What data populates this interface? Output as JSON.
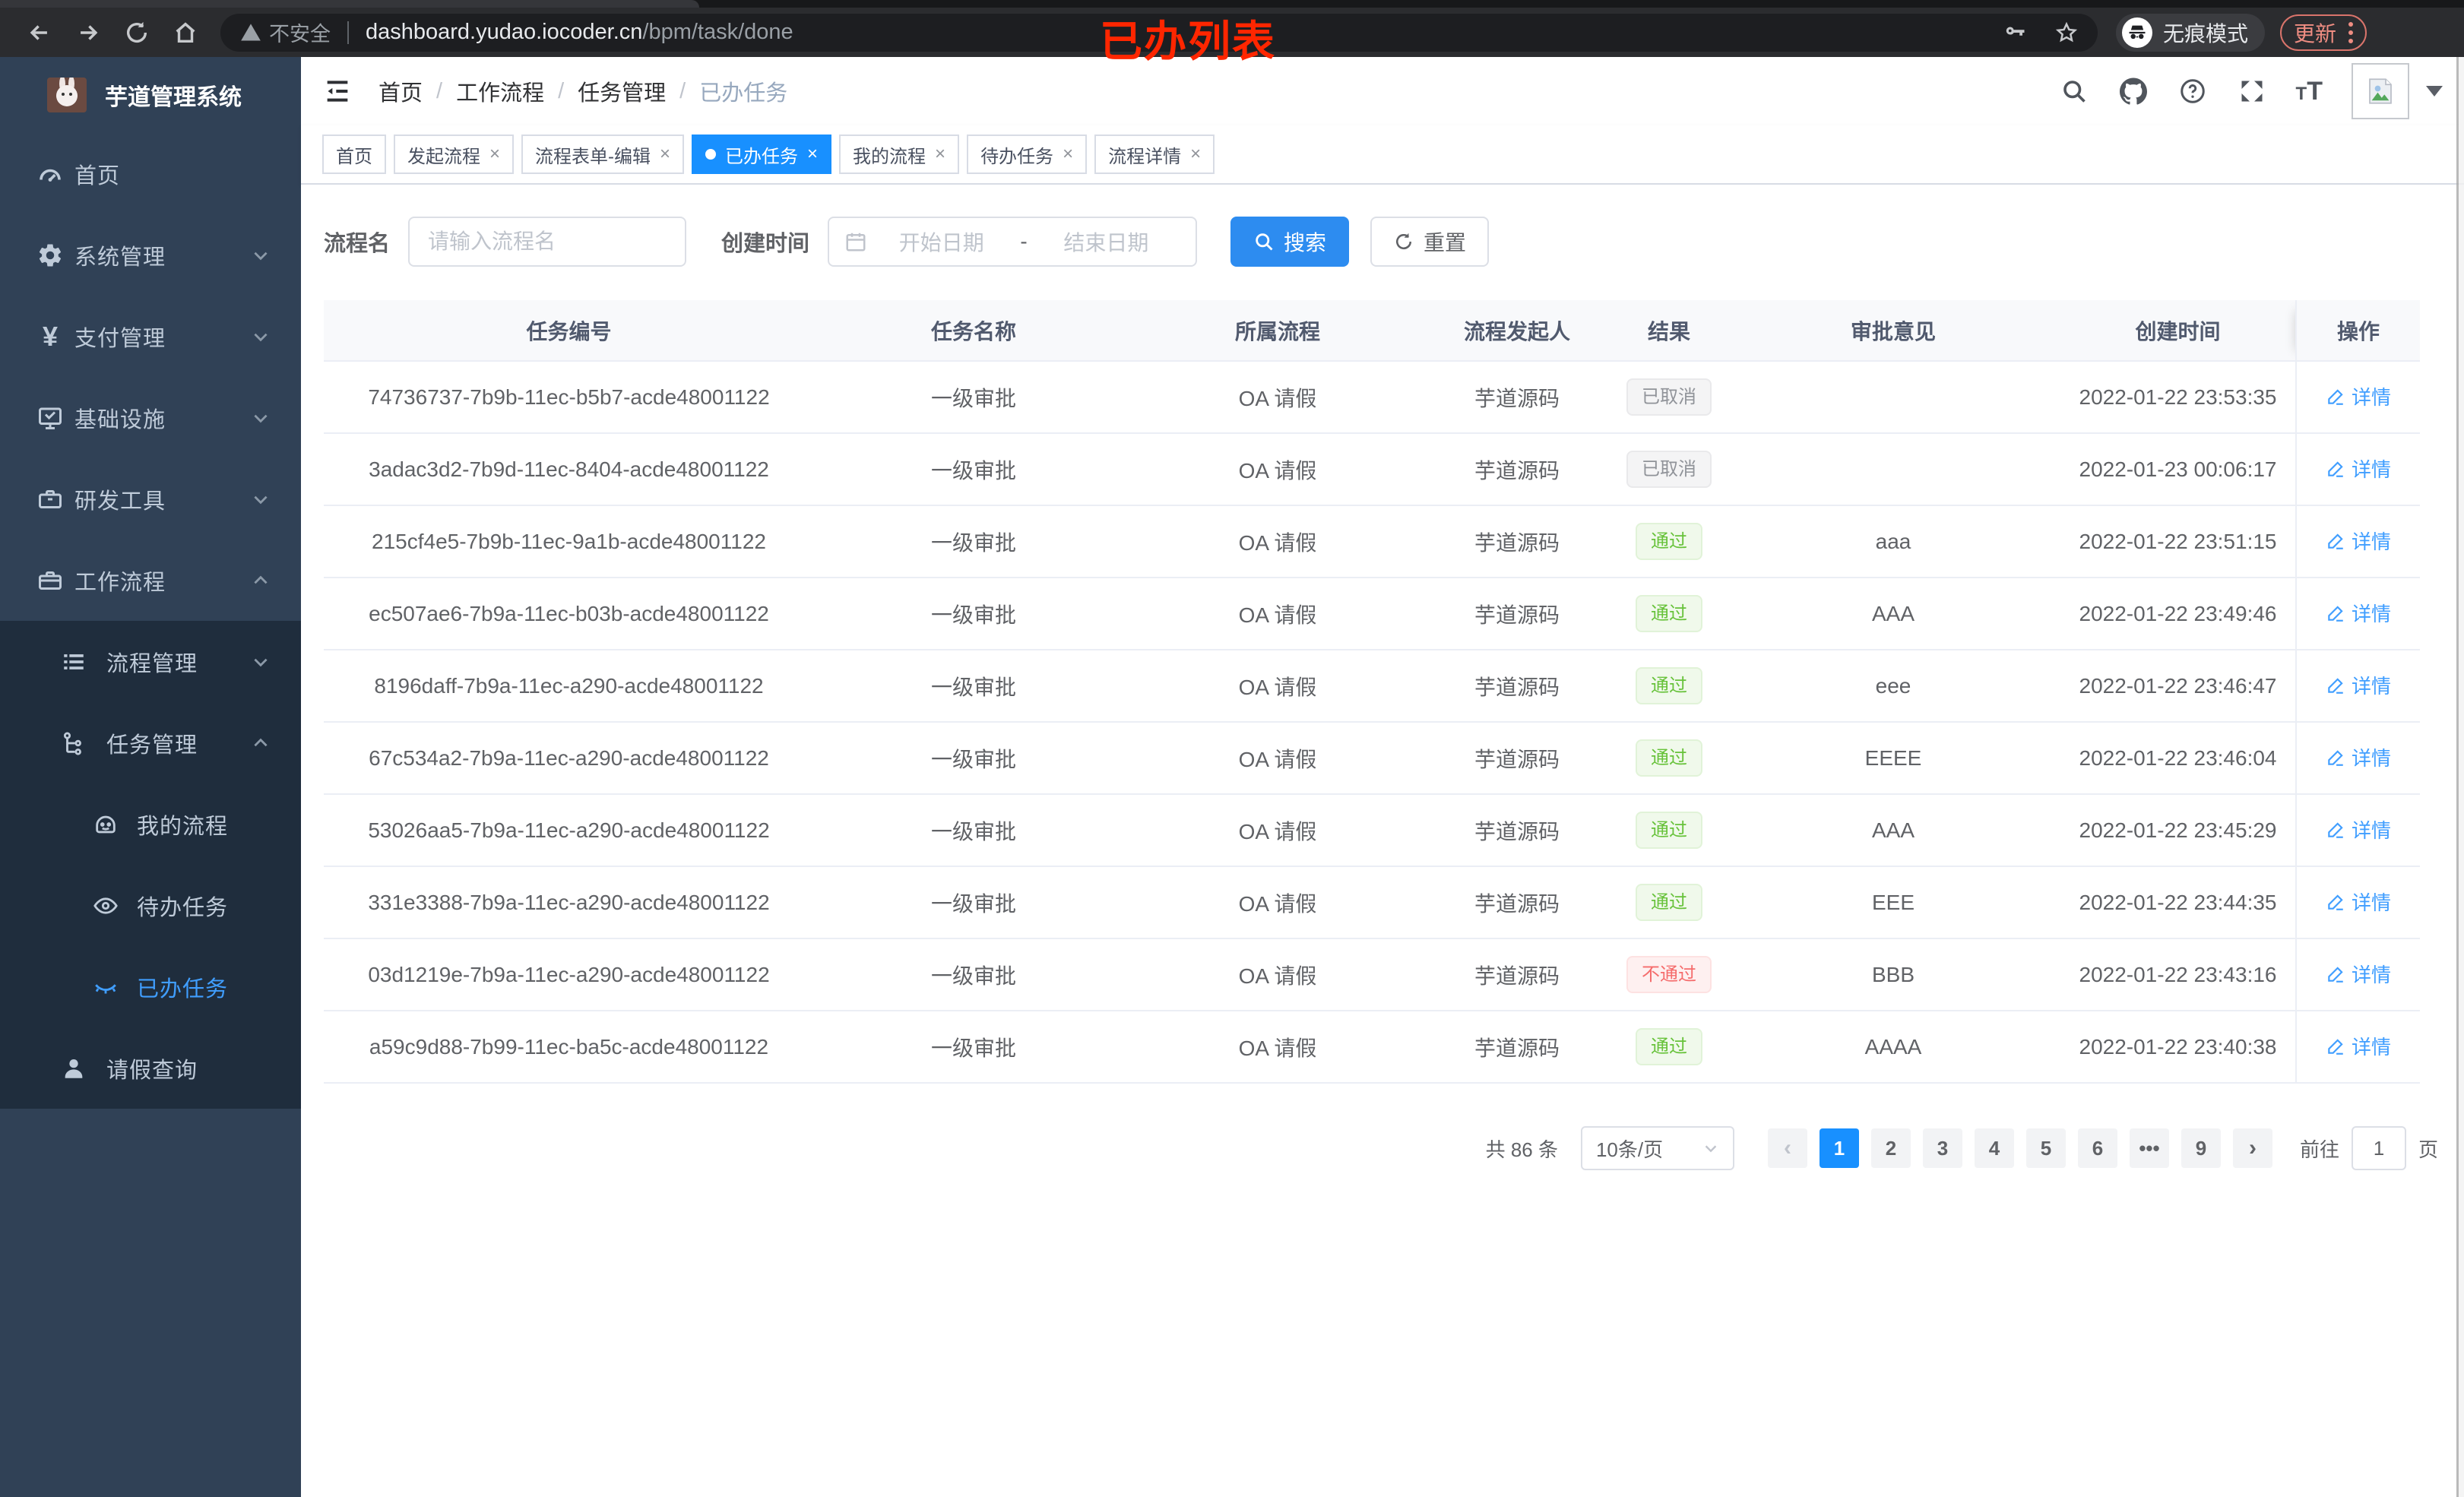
{
  "browser": {
    "not_secure": "不安全",
    "url_host": "dashboard.yudao.iocoder.cn",
    "url_path": "/bpm/task/done",
    "incognito_label": "无痕模式",
    "update_label": "更新"
  },
  "annotation": "已办列表",
  "sidebar": {
    "title": "芋道管理系统",
    "items": [
      {
        "label": "首页",
        "icon": "dashboard-icon"
      },
      {
        "label": "系统管理",
        "icon": "gear-icon"
      },
      {
        "label": "支付管理",
        "icon": "yen-icon"
      },
      {
        "label": "基础设施",
        "icon": "monitor-icon"
      },
      {
        "label": "研发工具",
        "icon": "toolbox-icon"
      },
      {
        "label": "工作流程",
        "icon": "briefcase-icon"
      }
    ],
    "submenu": {
      "process_mgmt": "流程管理",
      "task_mgmt": "任务管理",
      "my_process": "我的流程",
      "todo_tasks": "待办任务",
      "done_tasks": "已办任务",
      "leave_query": "请假查询"
    }
  },
  "breadcrumb": [
    "首页",
    "工作流程",
    "任务管理",
    "已办任务"
  ],
  "tabs": [
    {
      "label": "首页",
      "closable": false,
      "active": false
    },
    {
      "label": "发起流程",
      "closable": true,
      "active": false
    },
    {
      "label": "流程表单-编辑",
      "closable": true,
      "active": false
    },
    {
      "label": "已办任务",
      "closable": true,
      "active": true
    },
    {
      "label": "我的流程",
      "closable": true,
      "active": false
    },
    {
      "label": "待办任务",
      "closable": true,
      "active": false
    },
    {
      "label": "流程详情",
      "closable": true,
      "active": false
    }
  ],
  "filters": {
    "name_label": "流程名",
    "name_placeholder": "请输入流程名",
    "time_label": "创建时间",
    "start_placeholder": "开始日期",
    "range_separator": "-",
    "end_placeholder": "结束日期",
    "search_label": "搜索",
    "reset_label": "重置"
  },
  "table": {
    "columns": [
      "任务编号",
      "任务名称",
      "所属流程",
      "流程发起人",
      "结果",
      "审批意见",
      "创建时间",
      "操作"
    ],
    "action_label": "详情",
    "rows": [
      {
        "id": "74736737-7b9b-11ec-b5b7-acde48001122",
        "name": "一级审批",
        "process": "OA 请假",
        "initiator": "芋道源码",
        "result": "已取消",
        "result_type": "info",
        "comment": "",
        "created": "2022-01-22 23:53:35"
      },
      {
        "id": "3adac3d2-7b9d-11ec-8404-acde48001122",
        "name": "一级审批",
        "process": "OA 请假",
        "initiator": "芋道源码",
        "result": "已取消",
        "result_type": "info",
        "comment": "",
        "created": "2022-01-23 00:06:17"
      },
      {
        "id": "215cf4e5-7b9b-11ec-9a1b-acde48001122",
        "name": "一级审批",
        "process": "OA 请假",
        "initiator": "芋道源码",
        "result": "通过",
        "result_type": "success",
        "comment": "aaa",
        "created": "2022-01-22 23:51:15"
      },
      {
        "id": "ec507ae6-7b9a-11ec-b03b-acde48001122",
        "name": "一级审批",
        "process": "OA 请假",
        "initiator": "芋道源码",
        "result": "通过",
        "result_type": "success",
        "comment": "AAA",
        "created": "2022-01-22 23:49:46"
      },
      {
        "id": "8196daff-7b9a-11ec-a290-acde48001122",
        "name": "一级审批",
        "process": "OA 请假",
        "initiator": "芋道源码",
        "result": "通过",
        "result_type": "success",
        "comment": "eee",
        "created": "2022-01-22 23:46:47"
      },
      {
        "id": "67c534a2-7b9a-11ec-a290-acde48001122",
        "name": "一级审批",
        "process": "OA 请假",
        "initiator": "芋道源码",
        "result": "通过",
        "result_type": "success",
        "comment": "EEEE",
        "created": "2022-01-22 23:46:04"
      },
      {
        "id": "53026aa5-7b9a-11ec-a290-acde48001122",
        "name": "一级审批",
        "process": "OA 请假",
        "initiator": "芋道源码",
        "result": "通过",
        "result_type": "success",
        "comment": "AAA",
        "created": "2022-01-22 23:45:29"
      },
      {
        "id": "331e3388-7b9a-11ec-a290-acde48001122",
        "name": "一级审批",
        "process": "OA 请假",
        "initiator": "芋道源码",
        "result": "通过",
        "result_type": "success",
        "comment": "EEE",
        "created": "2022-01-22 23:44:35"
      },
      {
        "id": "03d1219e-7b9a-11ec-a290-acde48001122",
        "name": "一级审批",
        "process": "OA 请假",
        "initiator": "芋道源码",
        "result": "不通过",
        "result_type": "danger",
        "comment": "BBB",
        "created": "2022-01-22 23:43:16"
      },
      {
        "id": "a59c9d88-7b99-11ec-ba5c-acde48001122",
        "name": "一级审批",
        "process": "OA 请假",
        "initiator": "芋道源码",
        "result": "通过",
        "result_type": "success",
        "comment": "AAAA",
        "created": "2022-01-22 23:40:38"
      }
    ]
  },
  "pagination": {
    "total_label": "共 86 条",
    "page_size_label": "10条/页",
    "pages": [
      "1",
      "2",
      "3",
      "4",
      "5",
      "6",
      "•••",
      "9"
    ],
    "active_page": "1",
    "prev_glyph": "‹",
    "next_glyph": "›",
    "goto_label": "前往",
    "goto_value": "1",
    "goto_suffix": "页"
  },
  "colors": {
    "accent": "#409eff",
    "tab_active": "#1890ff",
    "button_primary": "#2d8cf0",
    "sidebar_bg": "#304156",
    "submenu_bg": "#1f2d3d",
    "success_text": "#67c23a",
    "success_bg": "#f0f9eb",
    "danger_text": "#f56c6c",
    "danger_bg": "#fef0f0",
    "info_text": "#909399",
    "info_bg": "#f4f4f5",
    "annotation": "#ff2600"
  }
}
